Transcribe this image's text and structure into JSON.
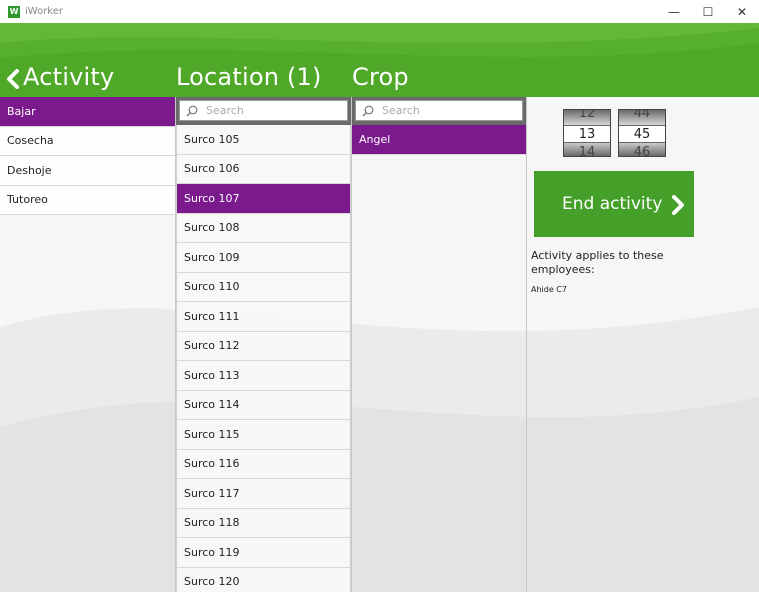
{
  "window": {
    "title": "iWorker",
    "icon_letter": "W",
    "minimize_glyph": "—",
    "maximize_glyph": "☐",
    "close_glyph": "✕"
  },
  "header": {
    "tabs": [
      {
        "label": "Activity"
      },
      {
        "label": "Location (1)"
      },
      {
        "label": "Crop"
      }
    ],
    "colors": {
      "header": "#4fa828",
      "selected": "#7b1a8c",
      "button": "#45a02a"
    }
  },
  "activities": [
    "Bajar",
    "Cosecha",
    "Deshoje",
    "Tutoreo"
  ],
  "location": {
    "search_placeholder": "Search",
    "items": [
      "Surco 105",
      "Surco 106",
      "Surco 107",
      "Surco 108",
      "Surco 109",
      "Surco 110",
      "Surco 111",
      "Surco 112",
      "Surco 113",
      "Surco 114",
      "Surco 115",
      "Surco 116",
      "Surco 117",
      "Surco 118",
      "Surco 119",
      "Surco 120"
    ]
  },
  "crop": {
    "search_placeholder": "Search",
    "items": [
      "Angel"
    ]
  },
  "time": {
    "hour_prev": "12",
    "hour": "13",
    "hour_next": "14",
    "minute_prev": "44",
    "minute": "45",
    "minute_next": "46"
  },
  "end_activity_label": "End activity",
  "applies_text": "Activity applies to these employees:",
  "employee": "Ahide C7"
}
